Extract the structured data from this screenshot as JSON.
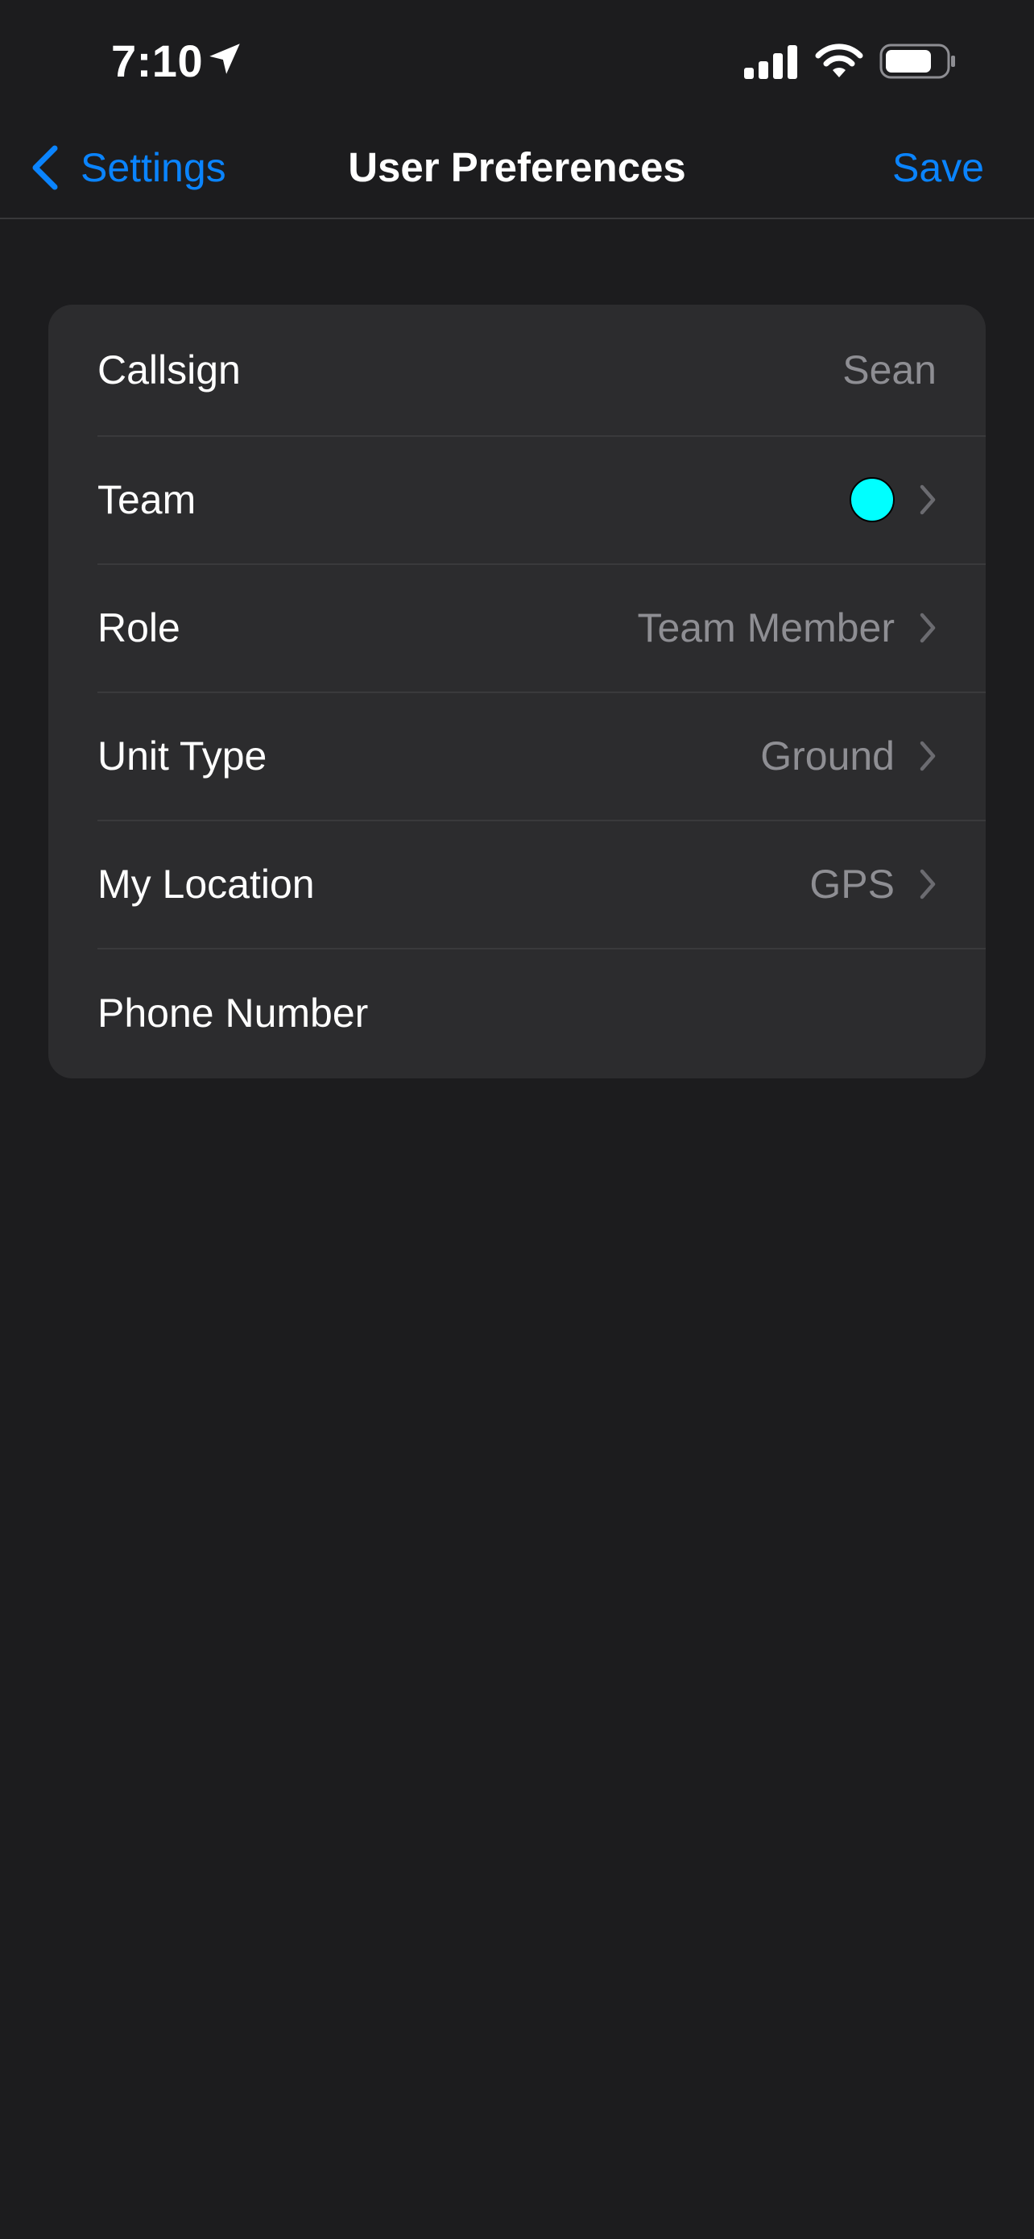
{
  "status_bar": {
    "time": "7:10",
    "icons": [
      "location-arrow-icon",
      "signal-icon",
      "wifi-icon",
      "battery-icon"
    ]
  },
  "nav": {
    "back_label": "Settings",
    "title": "User Preferences",
    "save_label": "Save"
  },
  "preferences": {
    "callsign": {
      "label": "Callsign",
      "value": "Sean"
    },
    "team": {
      "label": "Team",
      "color": "#00ffff"
    },
    "role": {
      "label": "Role",
      "value": "Team Member"
    },
    "unit_type": {
      "label": "Unit Type",
      "value": "Ground"
    },
    "my_location": {
      "label": "My Location",
      "value": "GPS"
    },
    "phone_number": {
      "label": "Phone Number",
      "value": ""
    }
  },
  "colors": {
    "background": "#1c1c1e",
    "card": "#2c2c2e",
    "accent": "#0a84ff",
    "secondary_text": "#8e8e93"
  }
}
